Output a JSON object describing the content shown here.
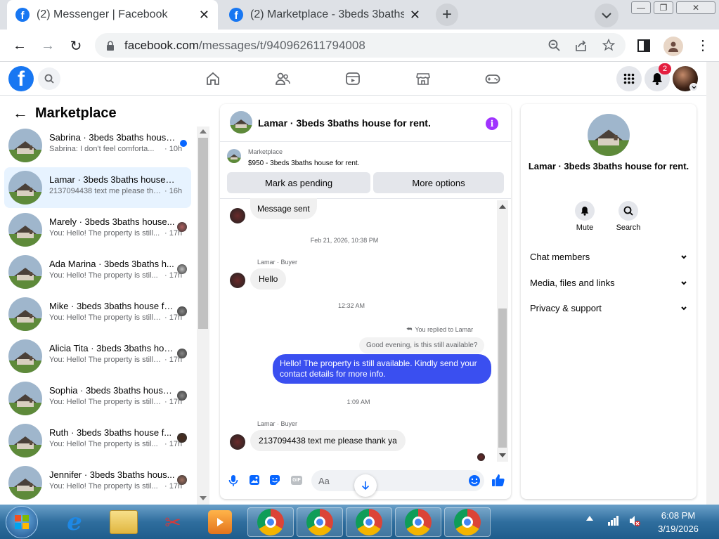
{
  "browser": {
    "tabs": [
      {
        "title": "(2) Messenger | Facebook",
        "active": true
      },
      {
        "title": "(2) Marketplace - 3beds 3baths h",
        "active": false
      }
    ],
    "url_host": "facebook.com",
    "url_path": "/messages/t/940962611794008"
  },
  "facebook": {
    "notification_count": "2"
  },
  "sidebar": {
    "title": "Marketplace",
    "conversations": [
      {
        "name": "Sabrina · 3beds 3baths house...",
        "preview": "Sabrina: I don't feel comforta...",
        "time": "· 10h",
        "unread": true
      },
      {
        "name": "Lamar · 3beds 3baths house fo...",
        "preview": "2137094438 text me please tha...",
        "time": "· 16h",
        "selected": true
      },
      {
        "name": "Marely · 3beds 3baths house...",
        "preview": "You: Hello! The property is still...",
        "time": "· 17h"
      },
      {
        "name": "Ada Marina · 3beds 3baths h...",
        "preview": "You: Hello! The property is stil...",
        "time": "· 17h"
      },
      {
        "name": "Mike · 3beds 3baths house for ...",
        "preview": "You: Hello! The property is still a...",
        "time": "· 17h"
      },
      {
        "name": "Alicia Tita · 3beds 3baths hous...",
        "preview": "You: Hello! The property is still a...",
        "time": "· 17h"
      },
      {
        "name": "Sophia · 3beds 3baths house f...",
        "preview": "You: Hello! The property is still a...",
        "time": "· 17h"
      },
      {
        "name": "Ruth · 3beds 3baths house f...",
        "preview": "You: Hello! The property is stil...",
        "time": "· 17h"
      },
      {
        "name": "Jennifer · 3beds 3baths hous...",
        "preview": "You: Hello! The property is stil...",
        "time": "· 17h"
      }
    ]
  },
  "chat": {
    "header_title": "Lamar · 3beds 3baths house for rent.",
    "listing_label": "Marketplace",
    "listing_text": "$950 - 3beds 3baths house for rent.",
    "mark_pending": "Mark as pending",
    "more_options": "More options",
    "msg_sent": "Message sent",
    "ts1": "Feb 21, 2026, 10:38 PM",
    "sender1": "Lamar · Buyer",
    "msg_hello": "Hello",
    "ts2": "12:32 AM",
    "replied_to": "You replied to Lamar",
    "quoted": "Good evening, is this still available?",
    "my_reply": "Hello! The property is still available. Kindly send your contact details for more info.",
    "ts3": "1:09 AM",
    "sender2": "Lamar · Buyer",
    "msg_last": "2137094438 text me please thank ya",
    "input_placeholder": "Aa",
    "gif_label": "GIF"
  },
  "details": {
    "title": "Lamar · 3beds 3baths house for rent.",
    "mute": "Mute",
    "search": "Search",
    "sections": [
      "Chat members",
      "Media, files and links",
      "Privacy & support"
    ]
  },
  "taskbar": {
    "time": "6:08 PM",
    "date": "3/19/2026"
  },
  "colors": {
    "fb_blue": "#1877f2",
    "my_bubble": "#3a4ff0",
    "selected_row": "#e7f3ff",
    "info_purple": "#a033ff"
  }
}
